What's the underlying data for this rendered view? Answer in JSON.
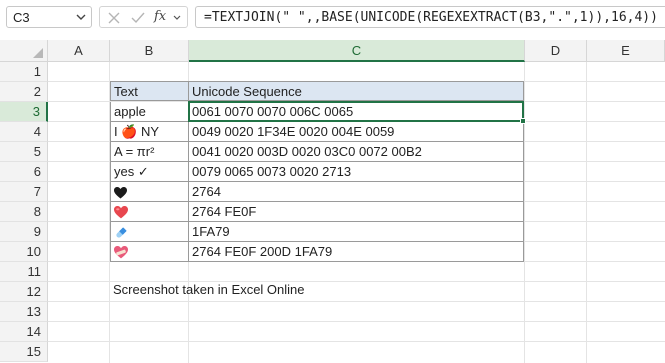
{
  "name_box": {
    "value": "C3"
  },
  "formula_bar": {
    "formula": "=TEXTJOIN(\" \",,BASE(UNICODE(REGEXEXTRACT(B3,\".\",1)),16,4))",
    "fx_label": "fx"
  },
  "columns": [
    "A",
    "B",
    "C",
    "D",
    "E"
  ],
  "rows": [
    "1",
    "2",
    "3",
    "4",
    "5",
    "6",
    "7",
    "8",
    "9",
    "10",
    "11",
    "12",
    "13",
    "14",
    "15"
  ],
  "active_cell": {
    "column": "C",
    "row": "3"
  },
  "table": {
    "headers": {
      "text": "Text",
      "sequence": "Unicode Sequence"
    },
    "rows": [
      {
        "text": "apple",
        "sequence": "0061 0070 0070 006C 0065"
      },
      {
        "text": "I 🍎 NY",
        "sequence": "0049 0020 1F34E 0020 004E 0059"
      },
      {
        "text": "A = πr²",
        "sequence": "0041 0020 003D 0020 03C0 0072 00B2"
      },
      {
        "text": "yes ✓",
        "sequence": "0079 0065 0073 0020 2713"
      },
      {
        "text": "",
        "icon": "black-heart",
        "sequence": "2764"
      },
      {
        "text": "",
        "icon": "red-heart",
        "sequence": "2764 FE0F"
      },
      {
        "text": "",
        "icon": "pill",
        "sequence": "1FA79"
      },
      {
        "text": "",
        "icon": "mending-heart",
        "sequence": "2764 FE0F 200D 1FA79"
      }
    ]
  },
  "note": "Screenshot taken in Excel Online",
  "colors": {
    "accent": "#217346",
    "header_fill": "#dce6f2"
  }
}
